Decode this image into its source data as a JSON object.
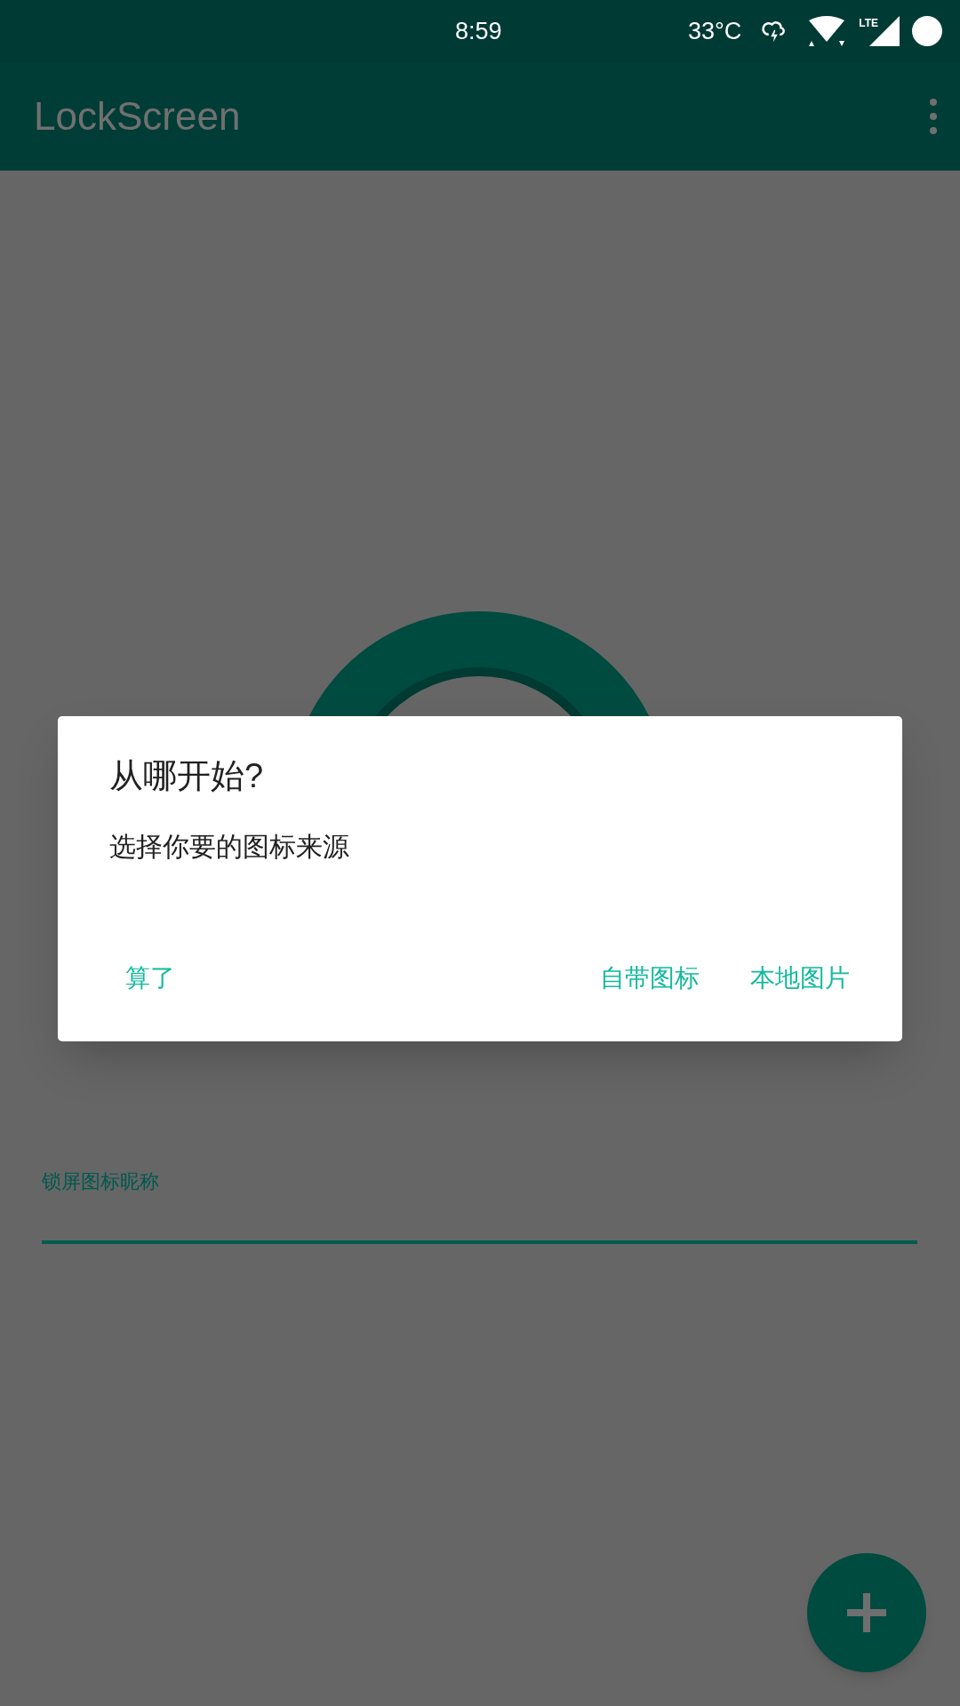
{
  "status_bar": {
    "time": "8:59",
    "temperature": "33°C",
    "network": "LTE"
  },
  "app_bar": {
    "title": "LockScreen"
  },
  "nickname_field": {
    "label": "锁屏图标昵称"
  },
  "dialog": {
    "title": "从哪开始?",
    "message": "选择你要的图标来源",
    "buttons": [
      {
        "label": "算了"
      },
      {
        "label": "自带图标"
      },
      {
        "label": "本地图片"
      }
    ]
  }
}
